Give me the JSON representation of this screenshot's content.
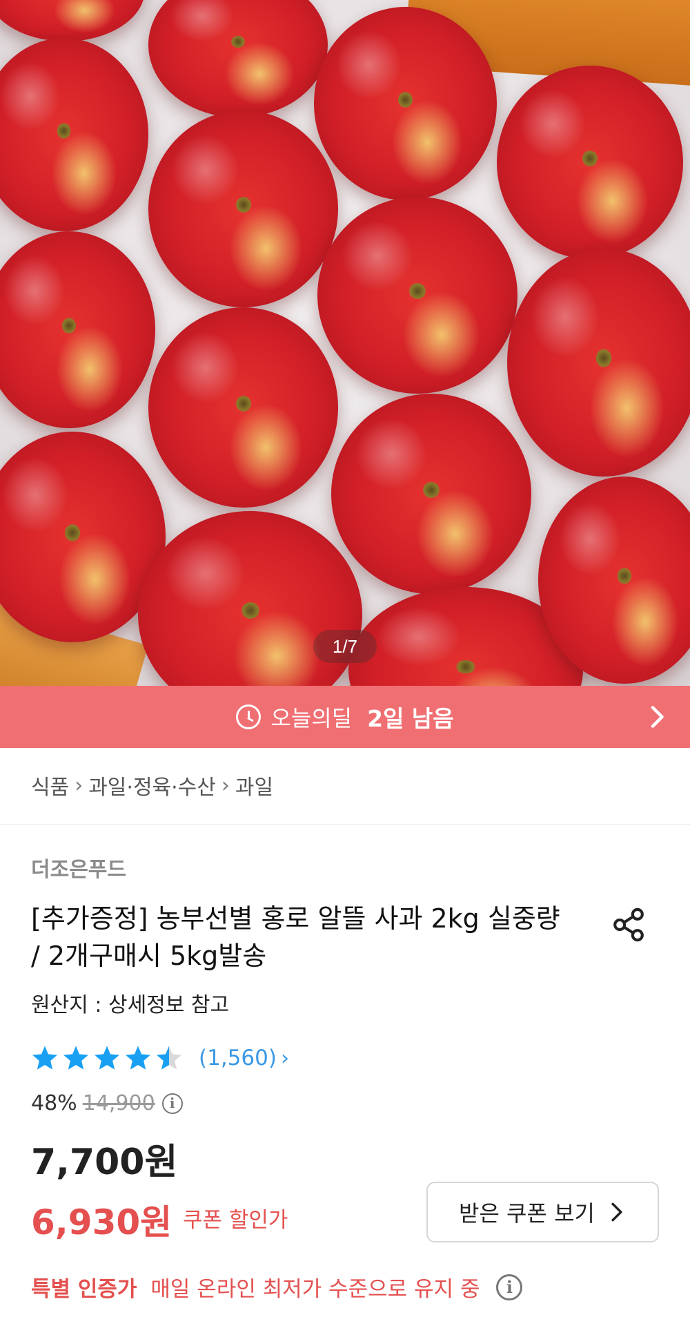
{
  "gallery": {
    "counter": "1/7"
  },
  "deal_banner": {
    "label": "오늘의딜",
    "remaining": "2일 남음",
    "accent_color": "#f06f73"
  },
  "breadcrumb": {
    "items": [
      "식품",
      "과일·정육·수산",
      "과일"
    ]
  },
  "product": {
    "seller": "더조은푸드",
    "title": "[추가증정] 농부선별 홍로 알뜰 사과 2kg 실중량 / 2개구매시 5kg발송",
    "origin": "원산지 : 상세정보 참고",
    "rating": {
      "stars": 4.5,
      "max_stars": 5,
      "review_count": "(1,560)",
      "star_color": "#1aa0f2"
    },
    "discount_percent": "48%",
    "original_price": "14,900",
    "price": "7,700원",
    "coupon_price": "6,930원",
    "coupon_label": "쿠폰 할인가",
    "coupon_button": "받은 쿠폰 보기"
  },
  "certification": {
    "badge": "특별 인증가",
    "text": "매일 온라인 최저가 수준으로 유지 중"
  },
  "icons": [
    "clock-icon",
    "chevron-right-icon",
    "share-icon",
    "star-icon",
    "info-icon"
  ]
}
